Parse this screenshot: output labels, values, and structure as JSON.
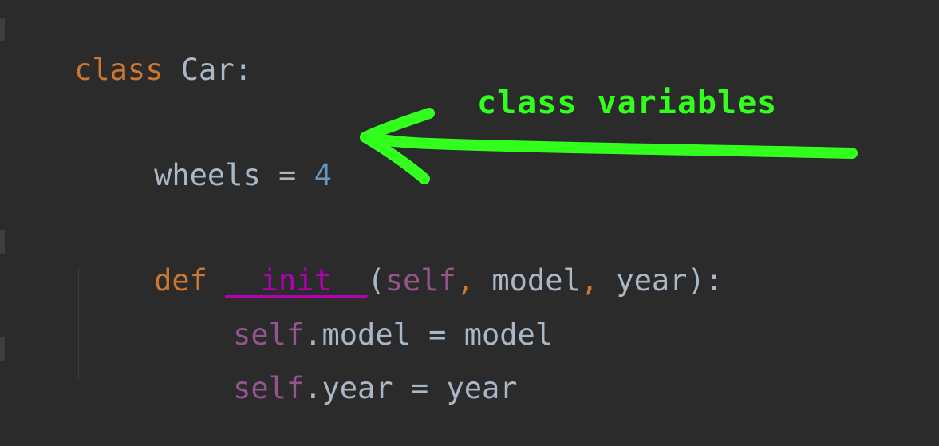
{
  "code": {
    "line1": {
      "keyword": "class",
      "name": "Car",
      "colon": ":"
    },
    "line2": {
      "var": "wheels",
      "op": "=",
      "value": "4"
    },
    "line3": {
      "keyword": "def",
      "func": "__init__",
      "open": "(",
      "self": "self",
      "comma1": ",",
      "p1": "model",
      "comma2": ",",
      "p2": "year",
      "close": "):"
    },
    "line4": {
      "self": "self",
      "attr": ".model",
      "op": "=",
      "value": "model"
    },
    "line5": {
      "self": "self",
      "attr": ".year",
      "op": "=",
      "value": "year"
    }
  },
  "annotation": {
    "text": "class variables",
    "color": "#33ff1f"
  },
  "colors": {
    "background": "#2b2b2b",
    "keyword": "#cc7832",
    "number": "#6897bb",
    "dunder": "#b200b2",
    "self": "#94558d",
    "text": "#a9b7c6"
  }
}
